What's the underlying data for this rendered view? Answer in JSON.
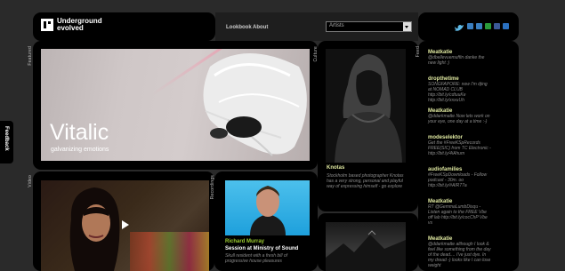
{
  "header": {
    "logo_line1": "Underground",
    "logo_line2": "evolved",
    "nav": [
      "Lookbook",
      "About"
    ],
    "artist_select": "Artists"
  },
  "sections": {
    "featured": "Featured",
    "culture": "Culture",
    "feed": "Feed",
    "video": "Video",
    "recordings": "Recordings"
  },
  "featured": {
    "title": "Vitalic",
    "subtitle": "galvanizing emotions"
  },
  "culture": {
    "title": "Knotas",
    "text": "Stockholm based photographer Knotas has a very strong, personal and playful way of expressing himself - go explore"
  },
  "recording": {
    "artist": "Richard Murray",
    "title": "Session at Ministry of Sound",
    "text": "Skull resident with a fresh bill of progressive house pleasures"
  },
  "feed": [
    {
      "user": "Meatkatie",
      "text": "@dbellevuemuffin danke the new light :)"
    },
    {
      "user": "dropthetime",
      "text": "SONGFAPORE: now I'm djing at NOMAD CLUB http://bit.ly/cdtuuKe http://bit.ly/xxxuUh"
    },
    {
      "user": "Meatkatie",
      "text": "@ddarkmatte Now lets work on your eye, one day at a time :-)"
    },
    {
      "user": "modeselektor",
      "text": "Get the #FreeKSpRecords FREE(SIC) from TC Electronic - http://bit.ly/4iAhum"
    },
    {
      "user": "audiofamilies",
      "text": "#FreeKSpDownloads - Follow podcast - 30m. oo http://bit.ly/#AIR77a"
    },
    {
      "user": "Meatkatie",
      "text": "RT @GemmaLumbDisqu - Listen again to the FREE Vbe off lab http://bit.ly/cocChP Vbe vs"
    },
    {
      "user": "Meatkatie",
      "text": "@ddarkmatte although I look & feel like something from the day of the dead.... I've just dye. In my dread -) looks like I can lose weight"
    }
  ],
  "feedback": "Feedback",
  "colors": {
    "twitter_user": "#dfe8a0",
    "recording_accent": "#9ccc30"
  }
}
